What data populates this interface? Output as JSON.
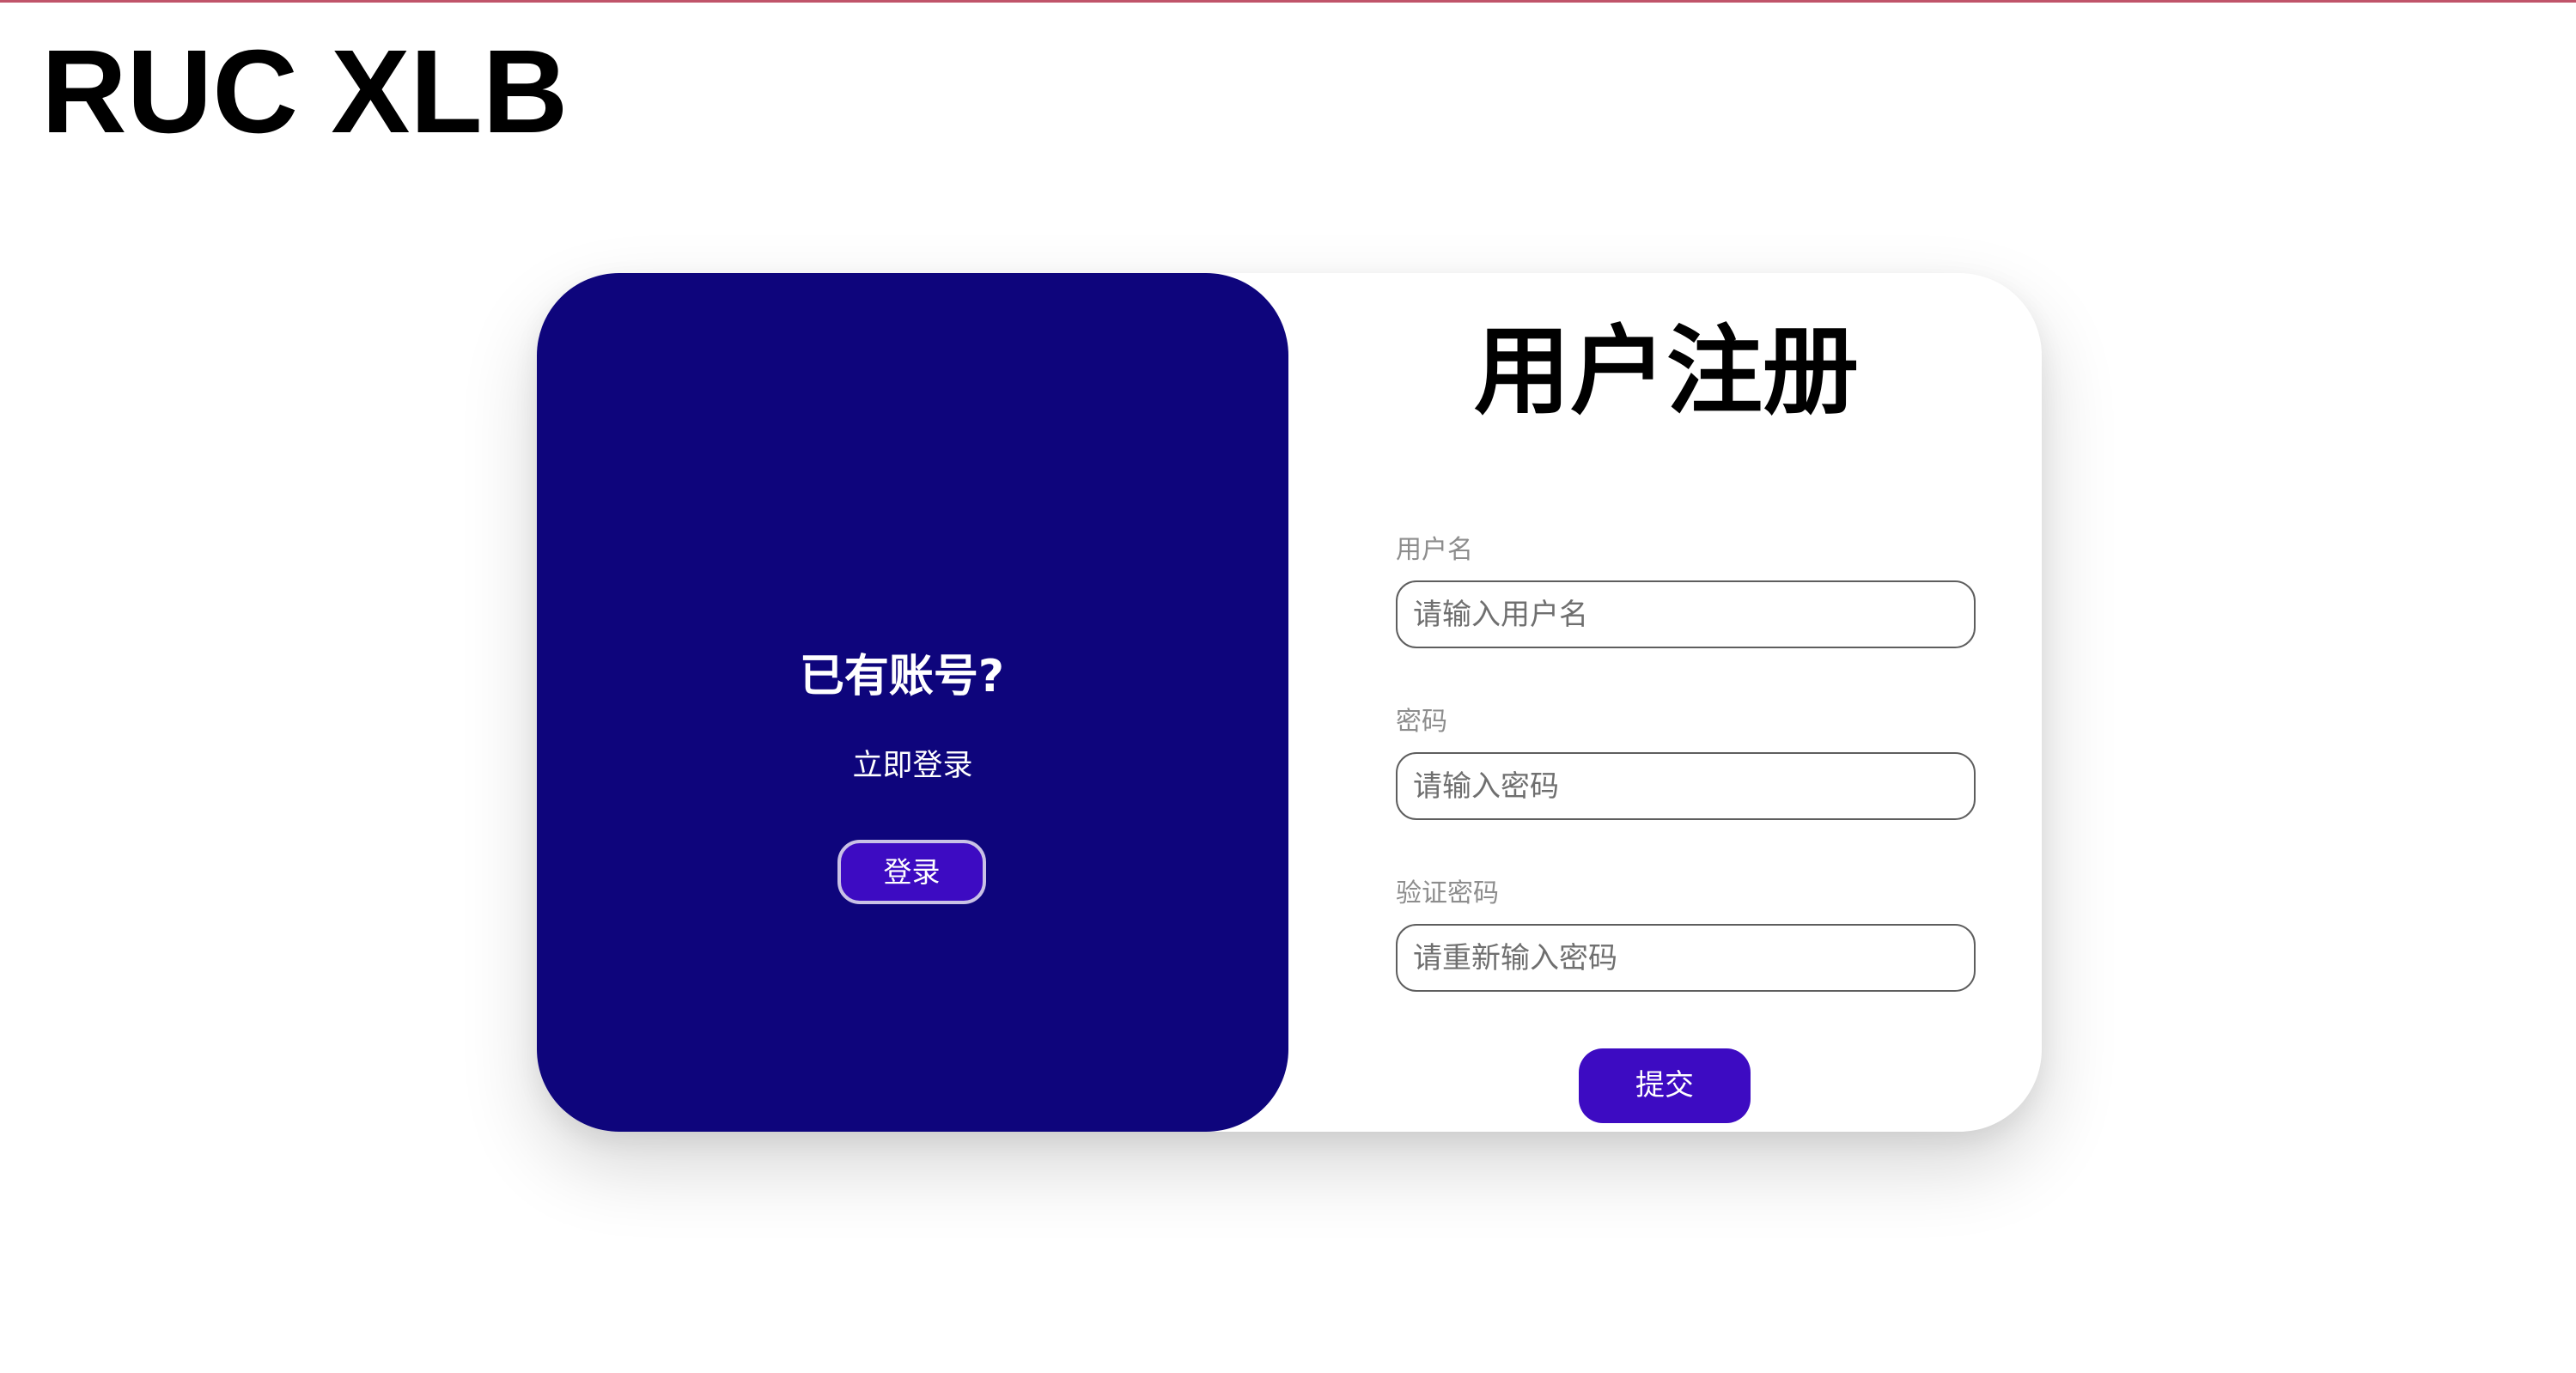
{
  "brand": {
    "logo_text": "RUC XLB"
  },
  "colors": {
    "left_panel_bg": "#0e057c",
    "button_bg": "#3d0bc2",
    "top_line": "#c0546a"
  },
  "login_panel": {
    "title": "已有账号?",
    "subtitle": "立即登录",
    "button_label": "登录"
  },
  "register_form": {
    "title": "用户注册",
    "fields": [
      {
        "label": "用户名",
        "placeholder": "请输入用户名",
        "value": ""
      },
      {
        "label": "密码",
        "placeholder": "请输入密码",
        "value": ""
      },
      {
        "label": "验证密码",
        "placeholder": "请重新输入密码",
        "value": ""
      }
    ],
    "submit_label": "提交"
  }
}
